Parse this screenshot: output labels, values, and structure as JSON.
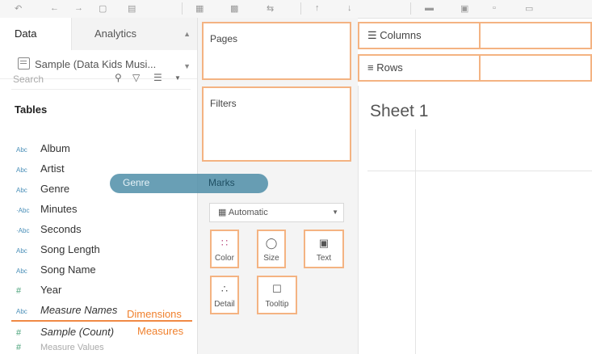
{
  "tabs": {
    "data": "Data",
    "analytics": "Analytics"
  },
  "datasource": "Sample (Data Kids Musi...",
  "search": {
    "placeholder": "Search"
  },
  "tables_heading": "Tables",
  "fields": [
    {
      "type": "Abc",
      "name": "Album"
    },
    {
      "type": "Abc",
      "name": "Artist"
    },
    {
      "type": "Abc",
      "name": "Genre"
    },
    {
      "type": "·Abc",
      "name": "Minutes"
    },
    {
      "type": "·Abc",
      "name": "Seconds"
    },
    {
      "type": "Abc",
      "name": "Song Length"
    },
    {
      "type": "Abc",
      "name": "Song Name"
    },
    {
      "type": "#",
      "name": "Year"
    },
    {
      "type": "Abc",
      "name": "Measure Names"
    },
    {
      "type": "#",
      "name": "Sample (Count)"
    },
    {
      "type": "#",
      "name": "Measure Values"
    }
  ],
  "drop_labels": {
    "dimensions": "Dimensions",
    "measures": "Measures"
  },
  "cards": {
    "pages": "Pages",
    "filters": "Filters",
    "marks": "Marks"
  },
  "mark_type": "Automatic",
  "mark_buttons": [
    {
      "label": "Color",
      "icon": "color-icon"
    },
    {
      "label": "Size",
      "icon": "size-icon"
    },
    {
      "label": "Text",
      "icon": "text-icon"
    },
    {
      "label": "Detail",
      "icon": "detail-icon"
    },
    {
      "label": "Tooltip",
      "icon": "tooltip-icon"
    }
  ],
  "shelves": {
    "columns": "Columns",
    "rows": "Rows"
  },
  "sheet_title": "Sheet 1",
  "drag_pill": {
    "field": "Genre",
    "target": "Marks"
  }
}
